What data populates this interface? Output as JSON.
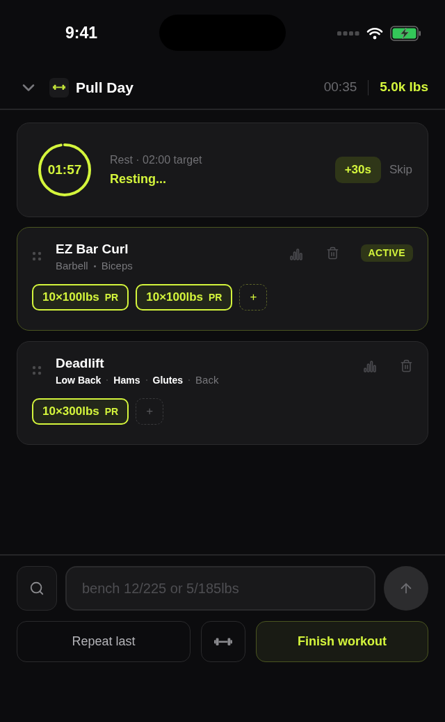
{
  "status_bar": {
    "time": "9:41"
  },
  "header": {
    "title": "Pull Day",
    "elapsed": "00:35",
    "volume": "5.0k lbs"
  },
  "rest_timer": {
    "time": "01:57",
    "caption": "Rest · 02:00 target",
    "status": "Resting...",
    "add_button": "+30s",
    "skip_button": "Skip"
  },
  "exercises": [
    {
      "name": "EZ Bar Curl",
      "active": true,
      "badge": "ACTIVE",
      "muscles": [
        {
          "label": "Barbell",
          "primary": false
        },
        {
          "label": "Biceps",
          "primary": false
        }
      ],
      "sets": [
        {
          "label": "10×100lbs",
          "pr": "PR"
        },
        {
          "label": "10×100lbs",
          "pr": "PR"
        }
      ],
      "add_label": "+"
    },
    {
      "name": "Deadlift",
      "active": false,
      "muscles": [
        {
          "label": "Low Back",
          "primary": true
        },
        {
          "label": "Hams",
          "primary": true
        },
        {
          "label": "Glutes",
          "primary": true
        },
        {
          "label": "Back",
          "primary": false
        }
      ],
      "sets": [
        {
          "label": "10×300lbs",
          "pr": "PR"
        }
      ],
      "add_label": "+"
    }
  ],
  "composer": {
    "placeholder": "bench 12/225 or 5/185lbs"
  },
  "actions": {
    "repeat": "Repeat last",
    "finish": "Finish workout"
  }
}
